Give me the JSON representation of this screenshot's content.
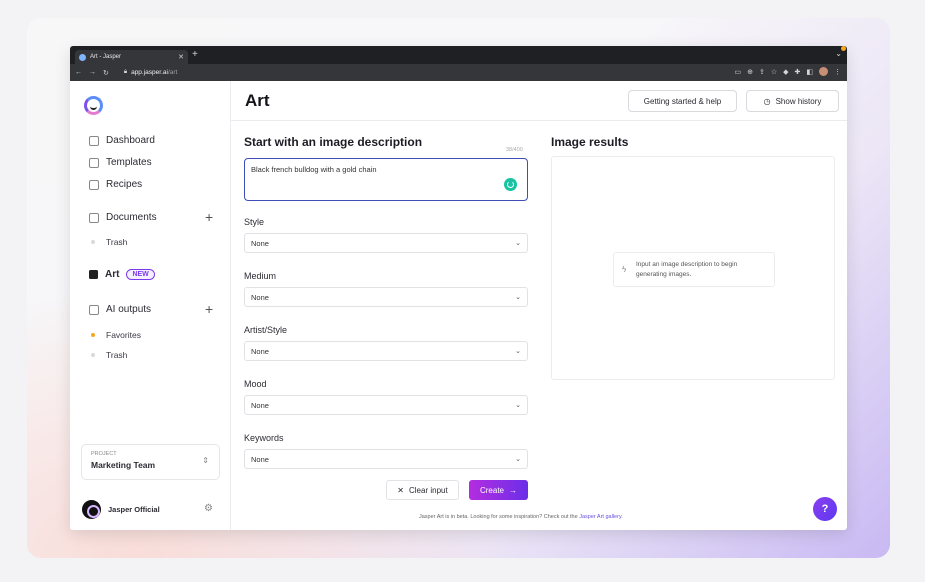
{
  "browser": {
    "tab_title": "Art - Jasper",
    "new_tab": "+",
    "url_host": "app.jasper.ai",
    "url_path": "/art"
  },
  "sidebar": {
    "nav": [
      {
        "label": "Dashboard"
      },
      {
        "label": "Templates"
      },
      {
        "label": "Recipes"
      }
    ],
    "documents": {
      "label": "Documents",
      "sub": "Trash"
    },
    "art": {
      "label": "Art",
      "badge": "NEW"
    },
    "ai_outputs": {
      "label": "AI outputs",
      "favorites": "Favorites",
      "trash": "Trash"
    },
    "project": {
      "label": "PROJECT",
      "value": "Marketing Team"
    },
    "user": {
      "name": "Jasper Official"
    }
  },
  "header": {
    "title": "Art",
    "help_button": "Getting started & help",
    "history_button": "Show history"
  },
  "form": {
    "title": "Start with an image description",
    "counter": "38/400",
    "description": "Black french bulldog with a gold chain",
    "fields": [
      {
        "label": "Style",
        "value": "None"
      },
      {
        "label": "Medium",
        "value": "None"
      },
      {
        "label": "Artist/Style",
        "value": "None"
      },
      {
        "label": "Mood",
        "value": "None"
      },
      {
        "label": "Keywords",
        "value": "None"
      }
    ],
    "clear_button": "Clear input",
    "create_button": "Create"
  },
  "results": {
    "title": "Image results",
    "hint": "Input an image description to begin generating images."
  },
  "footer": {
    "note": "Jasper Art is in beta. Looking for some inspiration? Check out the",
    "link": "Jasper Art gallery",
    "suffix": "."
  },
  "help_fab": "?"
}
